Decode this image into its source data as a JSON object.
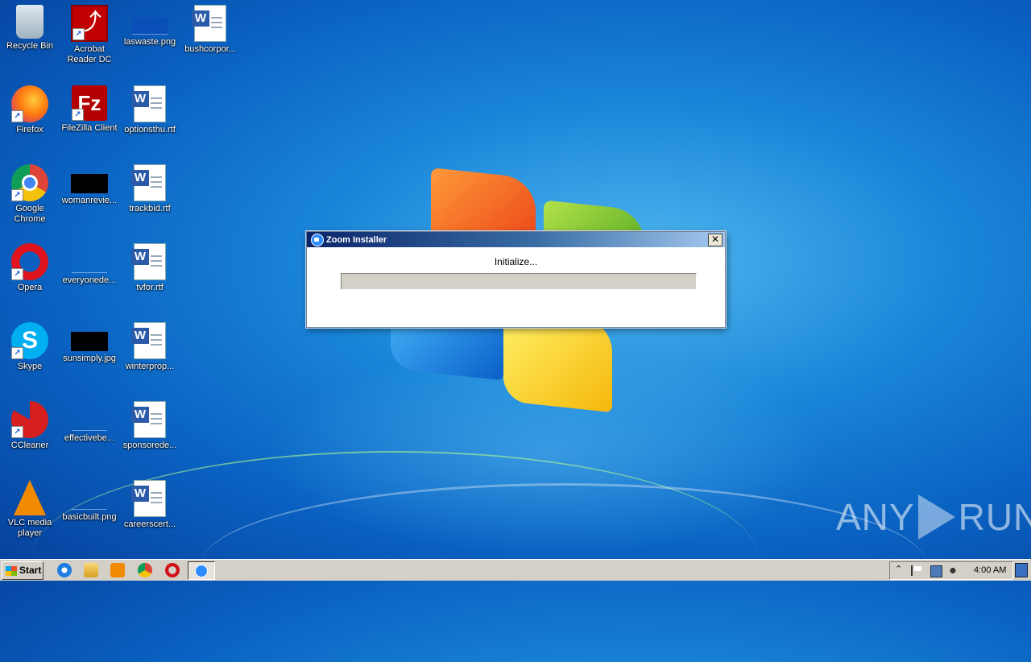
{
  "desktop": {
    "icons": [
      {
        "label": "Recycle Bin"
      },
      {
        "label": "Acrobat Reader DC"
      },
      {
        "label": "laswaste.png"
      },
      {
        "label": "bushcorpor..."
      },
      {
        "label": "Firefox"
      },
      {
        "label": "FileZilla Client"
      },
      {
        "label": "optionsthu.rtf"
      },
      {
        "label": "Google Chrome"
      },
      {
        "label": "womanrevie..."
      },
      {
        "label": "trackbid.rtf"
      },
      {
        "label": "Opera"
      },
      {
        "label": "everyonede..."
      },
      {
        "label": "tvfor.rtf"
      },
      {
        "label": "Skype"
      },
      {
        "label": "sunsimply.jpg"
      },
      {
        "label": "winterprop..."
      },
      {
        "label": "CCleaner"
      },
      {
        "label": "effectivebe..."
      },
      {
        "label": "sponsorede..."
      },
      {
        "label": "VLC media player"
      },
      {
        "label": "basicbuilt.png"
      },
      {
        "label": "careerscert..."
      }
    ]
  },
  "installer": {
    "title": "Zoom Installer",
    "close_glyph": "✕",
    "status": "Initialize...",
    "progress_fraction": 0.0
  },
  "taskbar": {
    "start_label": "Start",
    "clock": "4:00 AM",
    "tray_chevron": "⌃"
  },
  "watermark": {
    "left": "ANY",
    "right": "RUN"
  },
  "colors": {
    "titlebar_start": "#0a246a",
    "titlebar_end": "#a6caf0",
    "taskbar": "#d4d0c8",
    "progress_track": "#d4d0c8"
  }
}
